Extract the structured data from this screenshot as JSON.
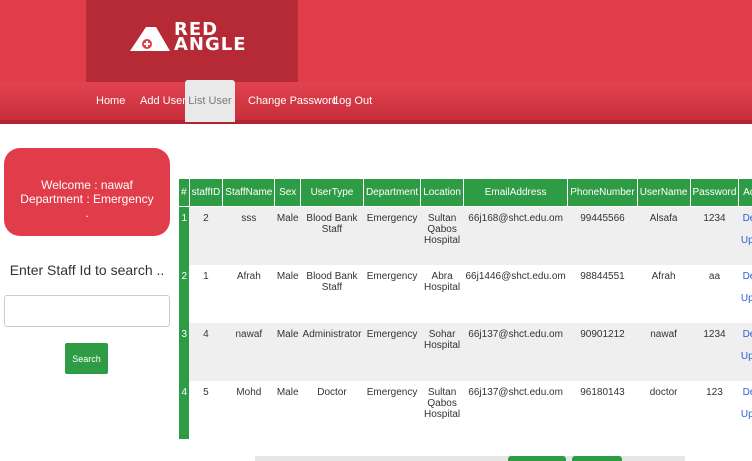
{
  "brand": {
    "line1": "RED",
    "line2": "ANGLE"
  },
  "nav": {
    "items": [
      {
        "label": "Home"
      },
      {
        "label": "Add User"
      },
      {
        "label": "List User",
        "active": true
      },
      {
        "label": "Change Password"
      },
      {
        "label": "Log Out"
      }
    ]
  },
  "sidebar": {
    "welcome_line": "Welcome : nawaf",
    "department_line": "Department : Emergency",
    "dot": ".",
    "search_label": "Enter Staff Id to search ..",
    "search_value": "",
    "search_button": "Search"
  },
  "table": {
    "headers": [
      "#",
      "staffID",
      "StaffName",
      "Sex",
      "UserType",
      "Department",
      "Location",
      "EmailAddress",
      "PhoneNumber",
      "UserName",
      "Password",
      "Action"
    ],
    "rows": [
      {
        "num": "1",
        "staff_id": "2",
        "name": "sss",
        "sex": "Male",
        "user_type": "Blood Bank Staff",
        "department": "Emergency",
        "location": "Sultan Qabos Hospital",
        "email": "66j168@shct.edu.om",
        "phone": "99445566",
        "username": "Alsafa",
        "password": "1234"
      },
      {
        "num": "2",
        "staff_id": "1",
        "name": "Afrah",
        "sex": "Male",
        "user_type": "Blood Bank Staff",
        "department": "Emergency",
        "location": "Abra Hospital",
        "email": "66j1446@shct.edu.om",
        "phone": "98844551",
        "username": "Afrah",
        "password": "aa"
      },
      {
        "num": "3",
        "staff_id": "4",
        "name": "nawaf",
        "sex": "Male",
        "user_type": "Administrator",
        "department": "Emergency",
        "location": "Sohar Hospital",
        "email": "66j137@shct.edu.om",
        "phone": "90901212",
        "username": "nawaf",
        "password": "1234"
      },
      {
        "num": "4",
        "staff_id": "5",
        "name": "Mohd",
        "sex": "Male",
        "user_type": "Doctor",
        "department": "Emergency",
        "location": "Sultan Qabos Hospital",
        "email": "66j137@shct.edu.om",
        "phone": "96180143",
        "username": "doctor",
        "password": "123"
      }
    ],
    "action": {
      "delete": "Delete",
      "separator": "|",
      "update": "Update"
    }
  },
  "colors": {
    "brand_red": "#e03c4a",
    "dark_red": "#b52a35",
    "table_green": "#2e9c45",
    "link_blue": "#2a5fd6"
  }
}
